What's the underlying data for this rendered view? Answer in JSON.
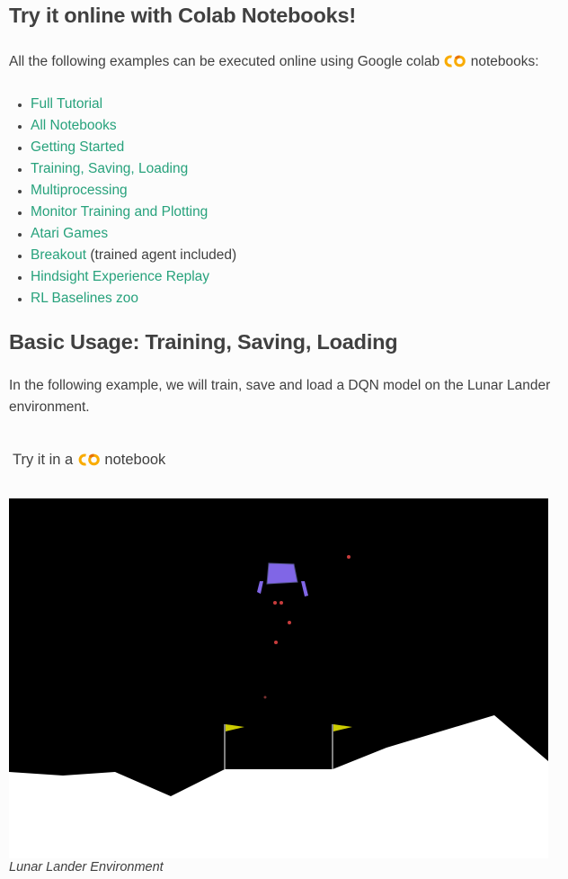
{
  "heading1": "Try it online with Colab Notebooks!",
  "intro": {
    "before": "All the following examples can be executed online using Google colab",
    "after": " notebooks:"
  },
  "links": [
    {
      "label": "Full Tutorial",
      "suffix": ""
    },
    {
      "label": "All Notebooks",
      "suffix": ""
    },
    {
      "label": "Getting Started",
      "suffix": ""
    },
    {
      "label": "Training, Saving, Loading",
      "suffix": ""
    },
    {
      "label": "Multiprocessing",
      "suffix": ""
    },
    {
      "label": "Monitor Training and Plotting",
      "suffix": ""
    },
    {
      "label": "Atari Games",
      "suffix": ""
    },
    {
      "label": "Breakout",
      "suffix": " (trained agent included)"
    },
    {
      "label": "Hindsight Experience Replay",
      "suffix": ""
    },
    {
      "label": "RL Baselines zoo",
      "suffix": ""
    }
  ],
  "heading2": "Basic Usage: Training, Saving, Loading",
  "paragraph": "In the following example, we will train, save and load a DQN model on the Lunar Lander environment.",
  "tryit": {
    "before": "Try it in a",
    "after": " notebook"
  },
  "figure": {
    "icon": "lunar-lander-render",
    "caption": "Lunar Lander Environment"
  },
  "colors": {
    "link": "#27a27c",
    "text": "#404040",
    "lander": "#8066e6",
    "flag": "#cccc00",
    "colab_orange": "#f9ab00",
    "colab_yellow": "#e8710a"
  }
}
